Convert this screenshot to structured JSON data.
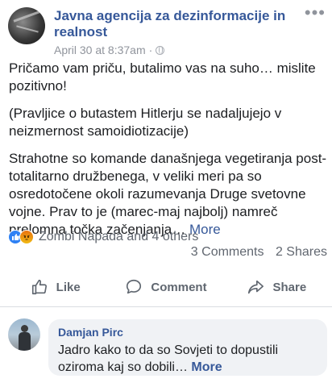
{
  "post": {
    "page_name": "Javna agencija za dezinformacije in realnost",
    "timestamp": "April 30 at 8:37am",
    "separator": "·",
    "paragraphs": [
      "Pričamo vam priču, butalimo vas na suho… mislite pozitivno!",
      "(Pravljice o butastem Hitlerju se nadaljujejo v neizmernost samoidiotizacije)"
    ],
    "last_paragraph": "Strahotne so komande današnjega vegetiranja post-totalitarno družbenega, v veliki meri pa so osredotočene okoli razumevanja Druge svetovne vojne. Prav to je (marec-maj najbolj) namreč prelomna točka začenjanja…",
    "more_label": "More"
  },
  "reactions": {
    "summary": "Zombi Napada and 4 others",
    "comments_count": "3 Comments",
    "shares_count": "2 Shares"
  },
  "actions": {
    "like": "Like",
    "comment": "Comment",
    "share": "Share"
  },
  "comment": {
    "author": "Damjan Pirc",
    "text": "Jadro kako to da so Sovjeti to dopustili oziroma kaj so dobili…",
    "more_label": "More"
  },
  "colors": {
    "link_blue": "#365899",
    "like_blue": "#2e81f4",
    "angry_orange": "#e9710f",
    "text": "#1c1e21",
    "muted": "#90949c"
  }
}
